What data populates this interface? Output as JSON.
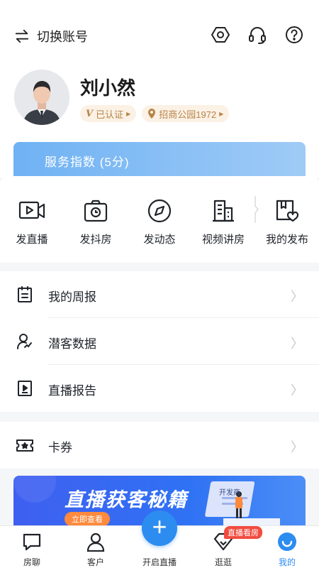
{
  "header": {
    "switch_account": "切换账号"
  },
  "profile": {
    "name": "刘小然",
    "verified_mark": "V",
    "verified_label": "已认证",
    "community_label": "招商公园1972"
  },
  "score": {
    "label": "服务指数 (5分)"
  },
  "actions": [
    {
      "label": "发直播",
      "icon": "live-video-icon"
    },
    {
      "label": "发抖房",
      "icon": "camera-icon"
    },
    {
      "label": "发动态",
      "icon": "compass-icon"
    },
    {
      "label": "视频讲房",
      "icon": "building-icon"
    },
    {
      "label": "我的发布",
      "icon": "heart-box-icon"
    }
  ],
  "menu_group_1": [
    {
      "label": "我的周报",
      "icon": "report-icon"
    },
    {
      "label": "潜客数据",
      "icon": "user-data-icon"
    },
    {
      "label": "直播报告",
      "icon": "play-report-icon"
    }
  ],
  "menu_group_2": [
    {
      "label": "卡券",
      "icon": "ticket-icon"
    }
  ],
  "banner": {
    "title": "直播获客秘籍",
    "cta": "立即查看",
    "mini_label": "开发商"
  },
  "tabbar": {
    "items": [
      {
        "label": "房聊",
        "icon": "chat-icon"
      },
      {
        "label": "客户",
        "icon": "person-icon"
      },
      {
        "label": "开启直播",
        "icon": "plus-icon"
      },
      {
        "label": "逛逛",
        "icon": "diamond-icon"
      },
      {
        "label": "我的",
        "icon": "smile-icon"
      }
    ],
    "center_symbol": "+",
    "live_tag": "直播看房"
  },
  "colors": {
    "accent": "#2d8cf0",
    "badge_text": "#b7844a",
    "badge_bg": "#fbf1e4",
    "live_tag": "#f24b3f"
  }
}
